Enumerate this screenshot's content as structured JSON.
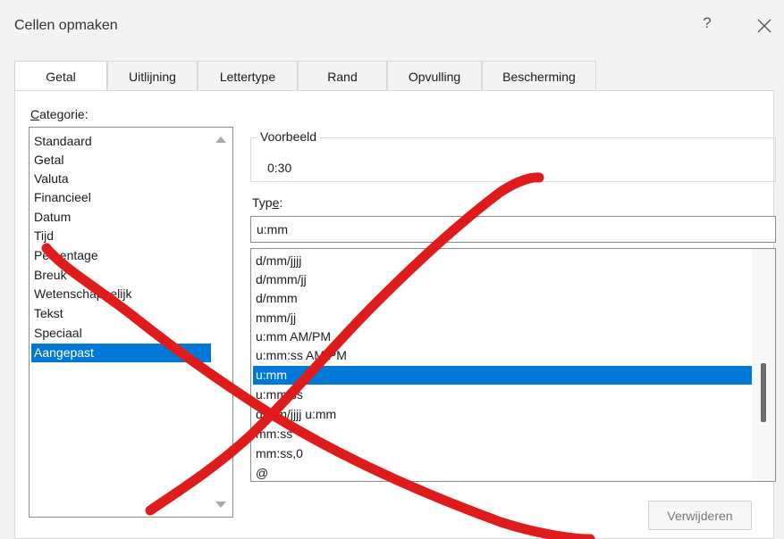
{
  "window": {
    "title": "Cellen opmaken",
    "help": "?",
    "close_icon": "close-icon"
  },
  "tabs": [
    {
      "label": "Getal",
      "active": true
    },
    {
      "label": "Uitlijning",
      "active": false
    },
    {
      "label": "Lettertype",
      "active": false
    },
    {
      "label": "Rand",
      "active": false
    },
    {
      "label": "Opvulling",
      "active": false
    },
    {
      "label": "Bescherming",
      "active": false
    }
  ],
  "category": {
    "label_first": "C",
    "label_rest": "ategorie:",
    "items": [
      "Standaard",
      "Getal",
      "Valuta",
      "Financieel",
      "Datum",
      "Tijd",
      "Percentage",
      "Breuk",
      "Wetenschappelijk",
      "Tekst",
      "Speciaal",
      "Aangepast"
    ],
    "selected": "Aangepast"
  },
  "preview": {
    "legend": "Voorbeeld",
    "value": "0:30"
  },
  "type": {
    "label_start": "Typ",
    "label_u": "e",
    "label_end": ":",
    "value": "u:mm"
  },
  "formats": {
    "items": [
      "d/mm/jjjj",
      "d/mmm/jj",
      "d/mmm",
      "mmm/jj",
      "u:mm AM/PM",
      "u:mm:ss AM/PM",
      "u:mm",
      "u:mm:ss",
      "d/mm/jjjj u:mm",
      "mm:ss",
      "mm:ss,0",
      "@"
    ],
    "selected": "u:mm"
  },
  "buttons": {
    "delete": "Verwijderen"
  },
  "colors": {
    "selection": "#0078d7",
    "annotation_red": "#e01b1b"
  }
}
